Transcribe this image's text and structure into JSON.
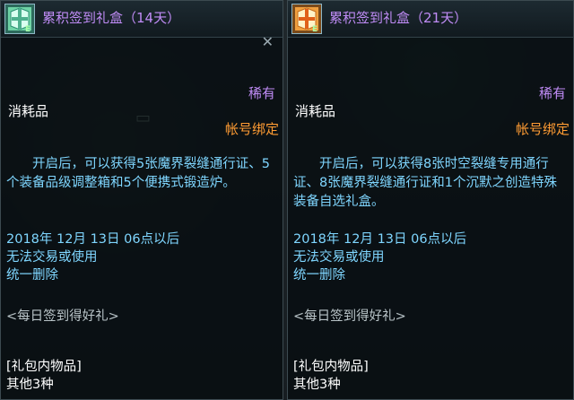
{
  "tooltips": [
    {
      "name": "累积签到礼盒（14天）",
      "rarity": "稀有",
      "type": "消耗品",
      "bind": "帐号绑定",
      "description": "开启后，可以获得5张魔界裂缝通行证、5个装备品级调整箱和5个便携式锻造炉。",
      "expire_lines": [
        "2018年 12月 13日 06点以后",
        "无法交易或使用",
        "统一删除"
      ],
      "source": "<每日签到得好礼>",
      "package_title": "[礼包内物品]",
      "package_count": "其他3种",
      "icon": "gift-box-icon",
      "icon_color": "#6fd3a6"
    },
    {
      "name": "累积签到礼盒（21天）",
      "rarity": "稀有",
      "type": "消耗品",
      "bind": "帐号绑定",
      "description": "开启后，可以获得8张时空裂缝专用通行证、8张魔界裂缝通行证和1个沉默之创造特殊装备自选礼盒。",
      "expire_lines": [
        "2018年 12月 13日 06点以后",
        "无法交易或使用",
        "统一删除"
      ],
      "source": "<每日签到得好礼>",
      "package_title": "[礼包内物品]",
      "package_count": "其他3种",
      "icon": "gift-box-icon",
      "icon_color": "#f0a040"
    }
  ],
  "colors": {
    "name": "#c08cf6",
    "bind": "#ff9c33",
    "description": "#7fd6ff"
  }
}
